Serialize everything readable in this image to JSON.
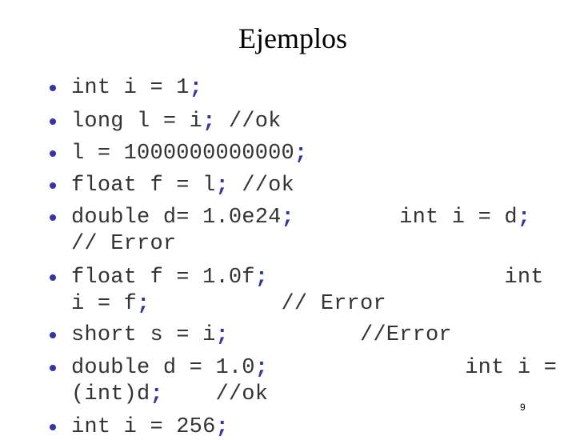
{
  "slide": {
    "title": "Ejemplos",
    "page_number": "9",
    "accent_color": "#3333aa",
    "text_color": "#333333",
    "items": [
      {
        "lines": [
          "int i = 1;"
        ]
      },
      {
        "lines": [
          "long l = i; //ok"
        ]
      },
      {
        "lines": [
          "l = 1000000000000;"
        ]
      },
      {
        "lines": [
          "float f = l; //ok"
        ]
      },
      {
        "lines": [
          "double d= 1.0e24;        int i = d;",
          "// Error"
        ]
      },
      {
        "lines": [
          "float f = 1.0f;                  int",
          "i = f;          // Error"
        ]
      },
      {
        "lines": [
          "short s = i;          //Error"
        ]
      },
      {
        "lines": [
          "double d = 1.0;               int i =",
          "(int)d;    //ok"
        ]
      },
      {
        "lines": [
          "int i = 256;"
        ]
      }
    ]
  }
}
